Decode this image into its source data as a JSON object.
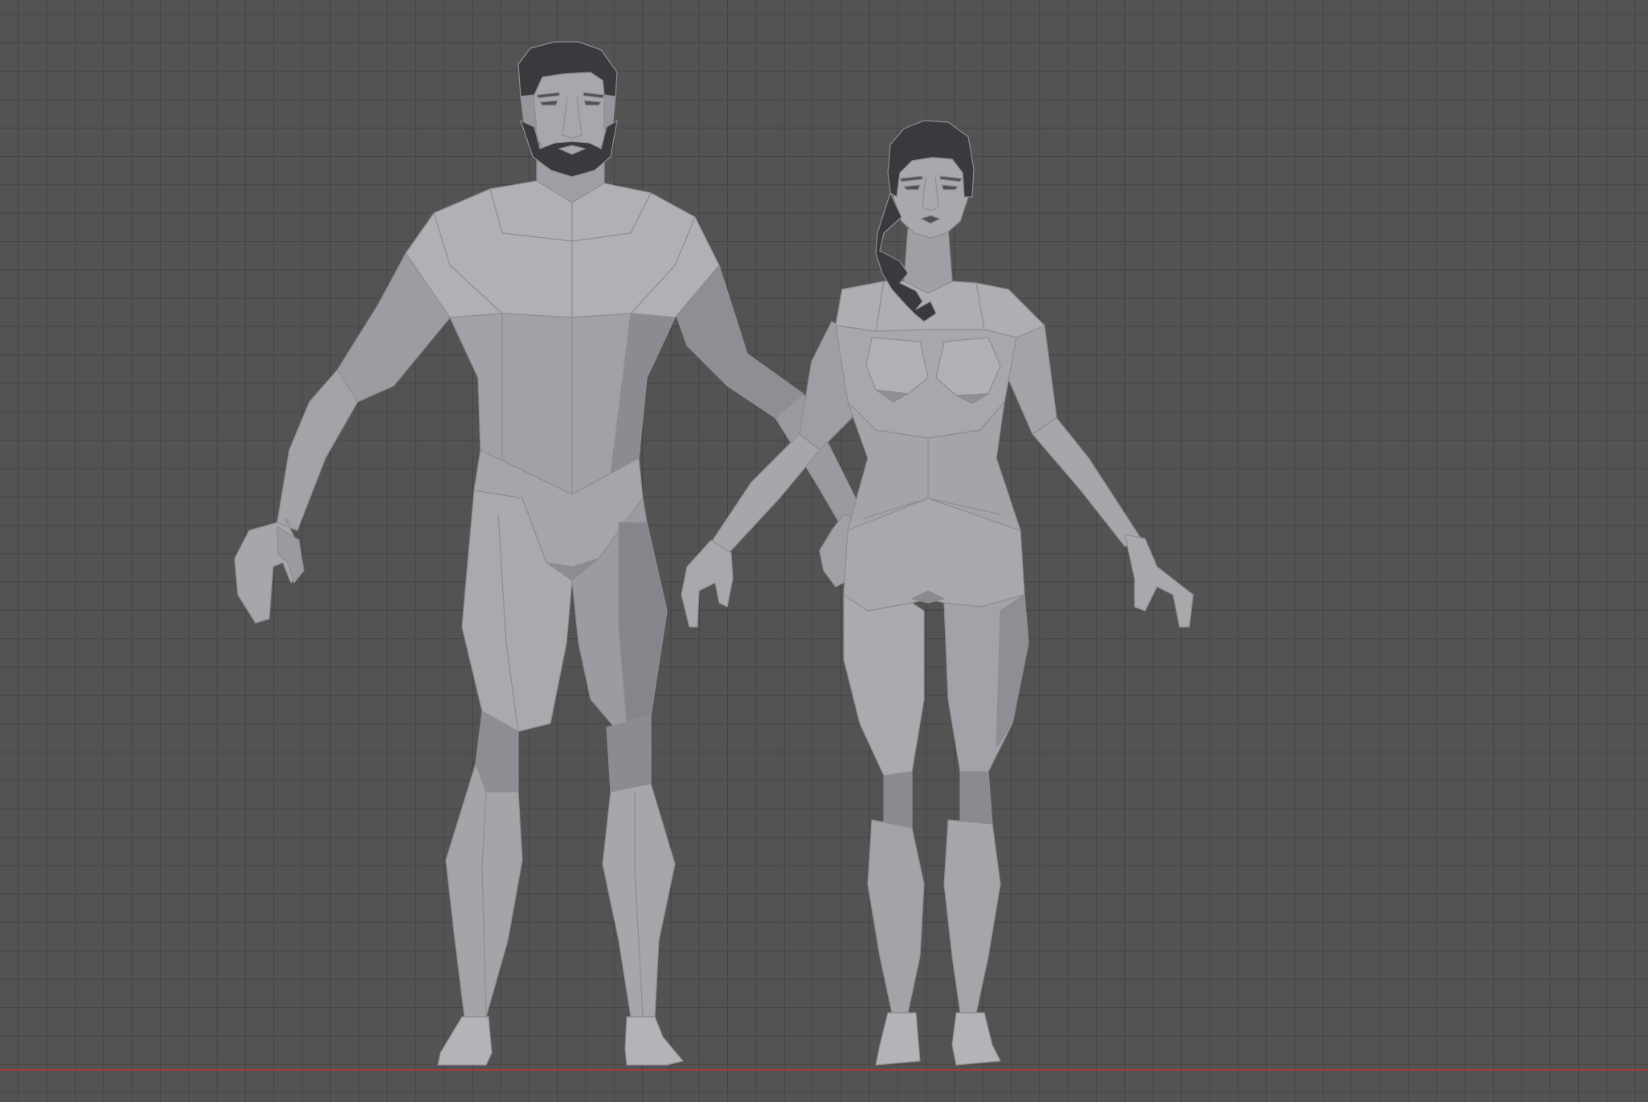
{
  "viewport": {
    "background_color": "#535353",
    "grid_line_color": "#444444",
    "ground_axis_color": "#a33a3a",
    "mesh_light_color": "#a9a9ae",
    "mesh_mid_color": "#9a9aa0",
    "mesh_dark_color": "#7e7e84",
    "hair_color": "#3a3a3e"
  },
  "objects": [
    {
      "label": "male-character"
    },
    {
      "label": "female-character"
    }
  ]
}
